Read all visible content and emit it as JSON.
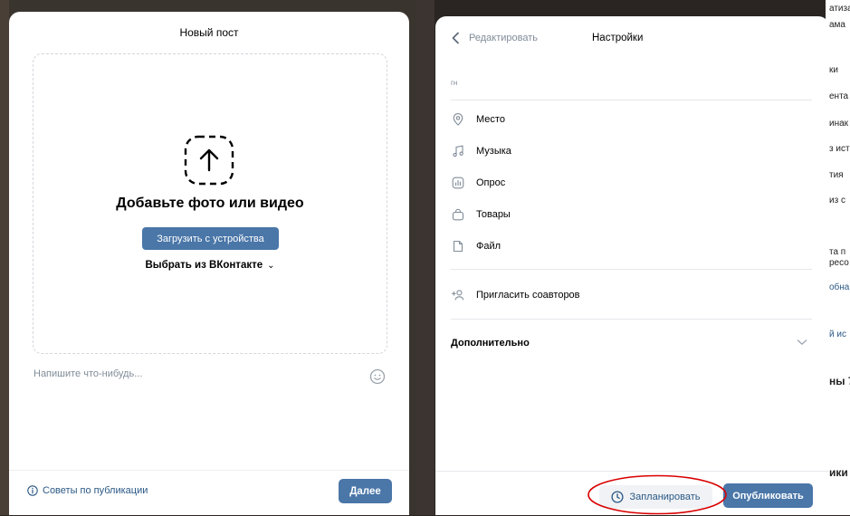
{
  "background": {
    "right_fragments": [
      "атиза",
      "ама",
      "ки",
      "ента",
      "инак",
      "з ист",
      "тия",
      "из с",
      "та п",
      "ресо",
      "обна",
      "й ис",
      "ны 7",
      "ики"
    ]
  },
  "new_post": {
    "title": "Новый пост",
    "dropzone": {
      "icon": "upload-arrow-icon",
      "heading": "Добавьте фото или видео",
      "upload_button": "Загрузить с устройства",
      "choose_vk": "Выбрать из ВКонтакте"
    },
    "input_placeholder": "Напишите что-нибудь...",
    "emoji_icon": "emoji-icon",
    "tips_link": "Советы по публикации",
    "next_button": "Далее"
  },
  "settings": {
    "back_label": "Редактировать",
    "title": "Настройки",
    "gn_label": "гн",
    "items": [
      {
        "label": "Место",
        "icon": "location-icon"
      },
      {
        "label": "Музыка",
        "icon": "music-icon"
      },
      {
        "label": "Опрос",
        "icon": "poll-icon"
      },
      {
        "label": "Товары",
        "icon": "shopping-bag-icon"
      },
      {
        "label": "Файл",
        "icon": "file-icon"
      }
    ],
    "invite_coauthors": "Пригласить соавторов",
    "advanced_label": "Дополнительно",
    "schedule_button": "Запланировать",
    "publish_button": "Опубликовать"
  },
  "colors": {
    "accent": "#4a76a8",
    "link": "#2a5885",
    "muted": "#818c99",
    "highlight": "#d90000"
  }
}
